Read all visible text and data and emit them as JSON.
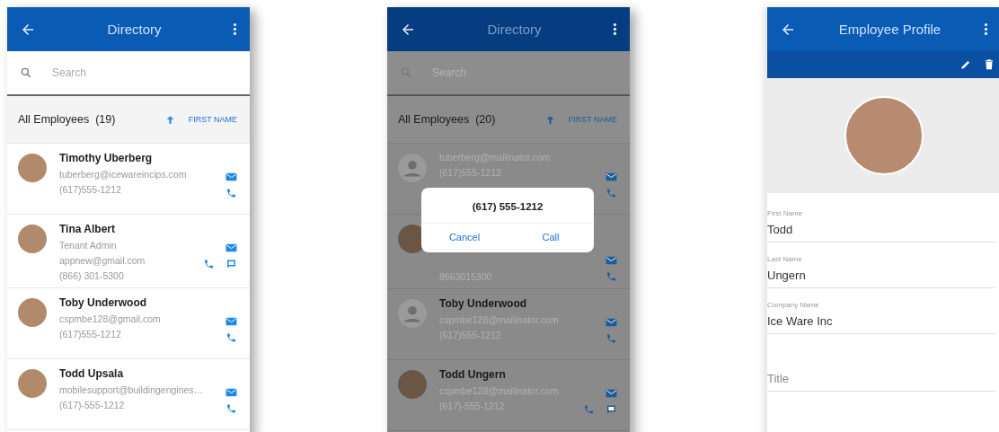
{
  "screens": [
    {
      "kind": "directory",
      "dimmed": false,
      "title": "Directory",
      "search": {
        "placeholder": "Search"
      },
      "list_header": {
        "label": "All Employees  (19)",
        "sort_label": "FIRST NAME"
      },
      "employees": [
        {
          "kind": "photo",
          "name": "Timothy Uberberg",
          "email": "tuberberg@icewareincips.com",
          "phone": "(617)555-1212",
          "chat": false
        },
        {
          "kind": "photo",
          "name": "Tina Albert",
          "role": "Tenant Admin",
          "email": "appnew@gmail.com",
          "phone": "(866) 301-5300",
          "chat": true
        },
        {
          "kind": "photo",
          "name": "Toby Underwood",
          "email": "cspmbe128@gmail.com",
          "phone": "(617)555-1212",
          "chat": false
        },
        {
          "kind": "photo",
          "name": "Todd Upsala",
          "email": "mobilesupport@buildingengines…",
          "phone": "(617)-555-1212",
          "chat": false
        }
      ]
    },
    {
      "kind": "directory",
      "dimmed": true,
      "title": "Directory",
      "search": {
        "placeholder": "Search"
      },
      "list_header": {
        "label": "All Employees  (20)",
        "sort_label": "FIRST NAME"
      },
      "employees": [
        {
          "kind": "silhouette",
          "email": "tuberberg@mailinator.com",
          "phone": "(617)555-1212",
          "chat": false
        },
        {
          "kind": "photo",
          "phone": "8663015300",
          "chat": false
        },
        {
          "kind": "silhouette",
          "name": "Toby Underwood",
          "email": "cspmbe128@mailinator.com",
          "phone": "(617)555-1212",
          "chat": false
        },
        {
          "kind": "photo",
          "name": "Todd Ungern",
          "email": "cspmbe128@mailinator.com",
          "phone": "(617)-555-1212",
          "chat": true
        }
      ],
      "dialog": {
        "text": "(617) 555-1212",
        "buttons": [
          "Cancel",
          "Call"
        ]
      }
    },
    {
      "kind": "profile",
      "title": "Employee Profile",
      "fields": [
        {
          "label": "First Name",
          "value": "Todd"
        },
        {
          "label": "Last Name",
          "value": "Ungern"
        },
        {
          "label": "Company Name",
          "value": "Ice Ware Inc"
        },
        {
          "placeholder": "Title"
        }
      ]
    }
  ]
}
